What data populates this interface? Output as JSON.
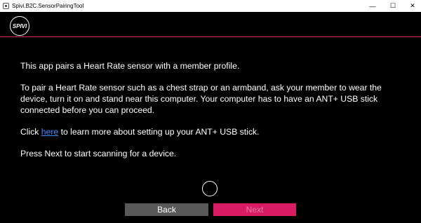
{
  "window": {
    "title": "Spivi.B2C.SensorPairingTool",
    "minimize": "—",
    "maximize": "☐",
    "close": "✕"
  },
  "header": {
    "logo_text": "SPIVI"
  },
  "colors": {
    "accent": "#e0245e",
    "next_bg": "#d81b62",
    "back_bg": "#595959",
    "link": "#3b8cff"
  },
  "content": {
    "p1": "This app pairs a Heart Rate sensor with a member profile.",
    "p2": "To pair a Heart Rate sensor such as a chest strap or an armband, ask your member to wear the device, turn it on and stand near this computer. Your computer has to have an ANT+ USB stick connected before you can proceed.",
    "p3_prefix": "Click ",
    "p3_link": "here",
    "p3_suffix": " to learn more about setting up your ANT+ USB stick.",
    "p4": "Press Next to start scanning for a device."
  },
  "buttons": {
    "back": "Back",
    "next": "Next"
  }
}
